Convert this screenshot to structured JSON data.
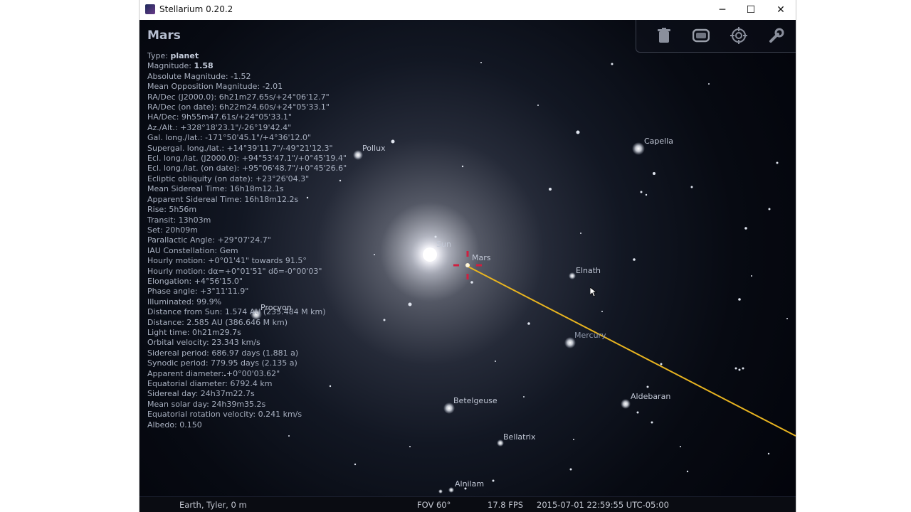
{
  "window": {
    "title": "Stellarium 0.20.2",
    "minimize_glyph": "─",
    "maximize_glyph": "☐",
    "close_glyph": "✕"
  },
  "object": {
    "name": "Mars",
    "type_label": "Type:",
    "type_value": "planet",
    "magnitude_label": "Magnitude:",
    "magnitude_value": "1.58",
    "lines": [
      "Absolute Magnitude: -1.52",
      "Mean Opposition Magnitude: -2.01",
      "RA/Dec (J2000.0): 6h21m27.65s/+24°06'12.7\"",
      "RA/Dec (on date): 6h22m24.60s/+24°05'33.1\"",
      "HA/Dec: 9h55m47.61s/+24°05'33.1\"",
      "Az./Alt.: +328°18'23.1\"/-26°19'42.4\"",
      "Gal. long./lat.: -171°50'45.1\"/+4°36'12.0\"",
      "Supergal. long./lat.: +14°39'11.7\"/-49°21'12.3\"",
      "Ecl. long./lat. (J2000.0): +94°53'47.1\"/+0°45'19.4\"",
      "Ecl. long./lat. (on date): +95°06'48.7\"/+0°45'26.6\"",
      "Ecliptic obliquity (on date): +23°26'04.3\"",
      "Mean Sidereal Time: 16h18m12.1s",
      "Apparent Sidereal Time: 16h18m12.2s",
      "Rise: 5h56m",
      "Transit: 13h03m",
      "Set: 20h09m",
      "Parallactic Angle: +29°07'24.7\"",
      "IAU Constellation: Gem",
      "Hourly motion: +0°01'41\" towards 91.5°",
      "Hourly motion: dα=+0°01'51\" dδ=-0°00'03\"",
      "Elongation: +4°56'15.0\"",
      "Phase angle: +3°11'11.9\"",
      "Illuminated: 99.9%",
      "Distance from Sun: 1.574 AU (235.484 M km)",
      "Distance: 2.585 AU (386.646 M km)",
      "Light time: 0h21m29.7s",
      "Orbital velocity: 23.343 km/s",
      "Sidereal period: 686.97 days (1.881 a)",
      "Synodic period: 779.95 days (2.135 a)",
      "Apparent diameter: +0°00'03.62\"",
      "Equatorial diameter: 6792.4 km",
      "Sidereal day: 24h37m22.7s",
      "Mean solar day: 24h39m35.2s",
      "Equatorial rotation velocity: 0.241 km/s",
      "Albedo: 0.150"
    ]
  },
  "labels": {
    "sun": "Sun",
    "mars": "Mars",
    "pollux": "Pollux",
    "capella": "Capella",
    "elnath": "Elnath",
    "procyon": "Procyon",
    "mercury": "Mercury",
    "aldebaran": "Aldebaran",
    "betelgeuse": "Betelgeuse",
    "bellatrix": "Bellatrix",
    "alnilam": "Alnilam"
  },
  "toolbar": {
    "icons": [
      "trash-icon",
      "screen-icon",
      "target-icon",
      "wrench-icon"
    ]
  },
  "status": {
    "location": "Earth, Tyler, 0 m",
    "fov": "FOV 60°",
    "fps": "17.8 FPS",
    "datetime": "2015-07-01 22:59:55 UTC-05:00"
  },
  "colors": {
    "ecliptic_line": "#e8b420",
    "selection_marker": "#d02040",
    "info_text": "#a8b0c0",
    "title_text": "#b6bed0"
  }
}
